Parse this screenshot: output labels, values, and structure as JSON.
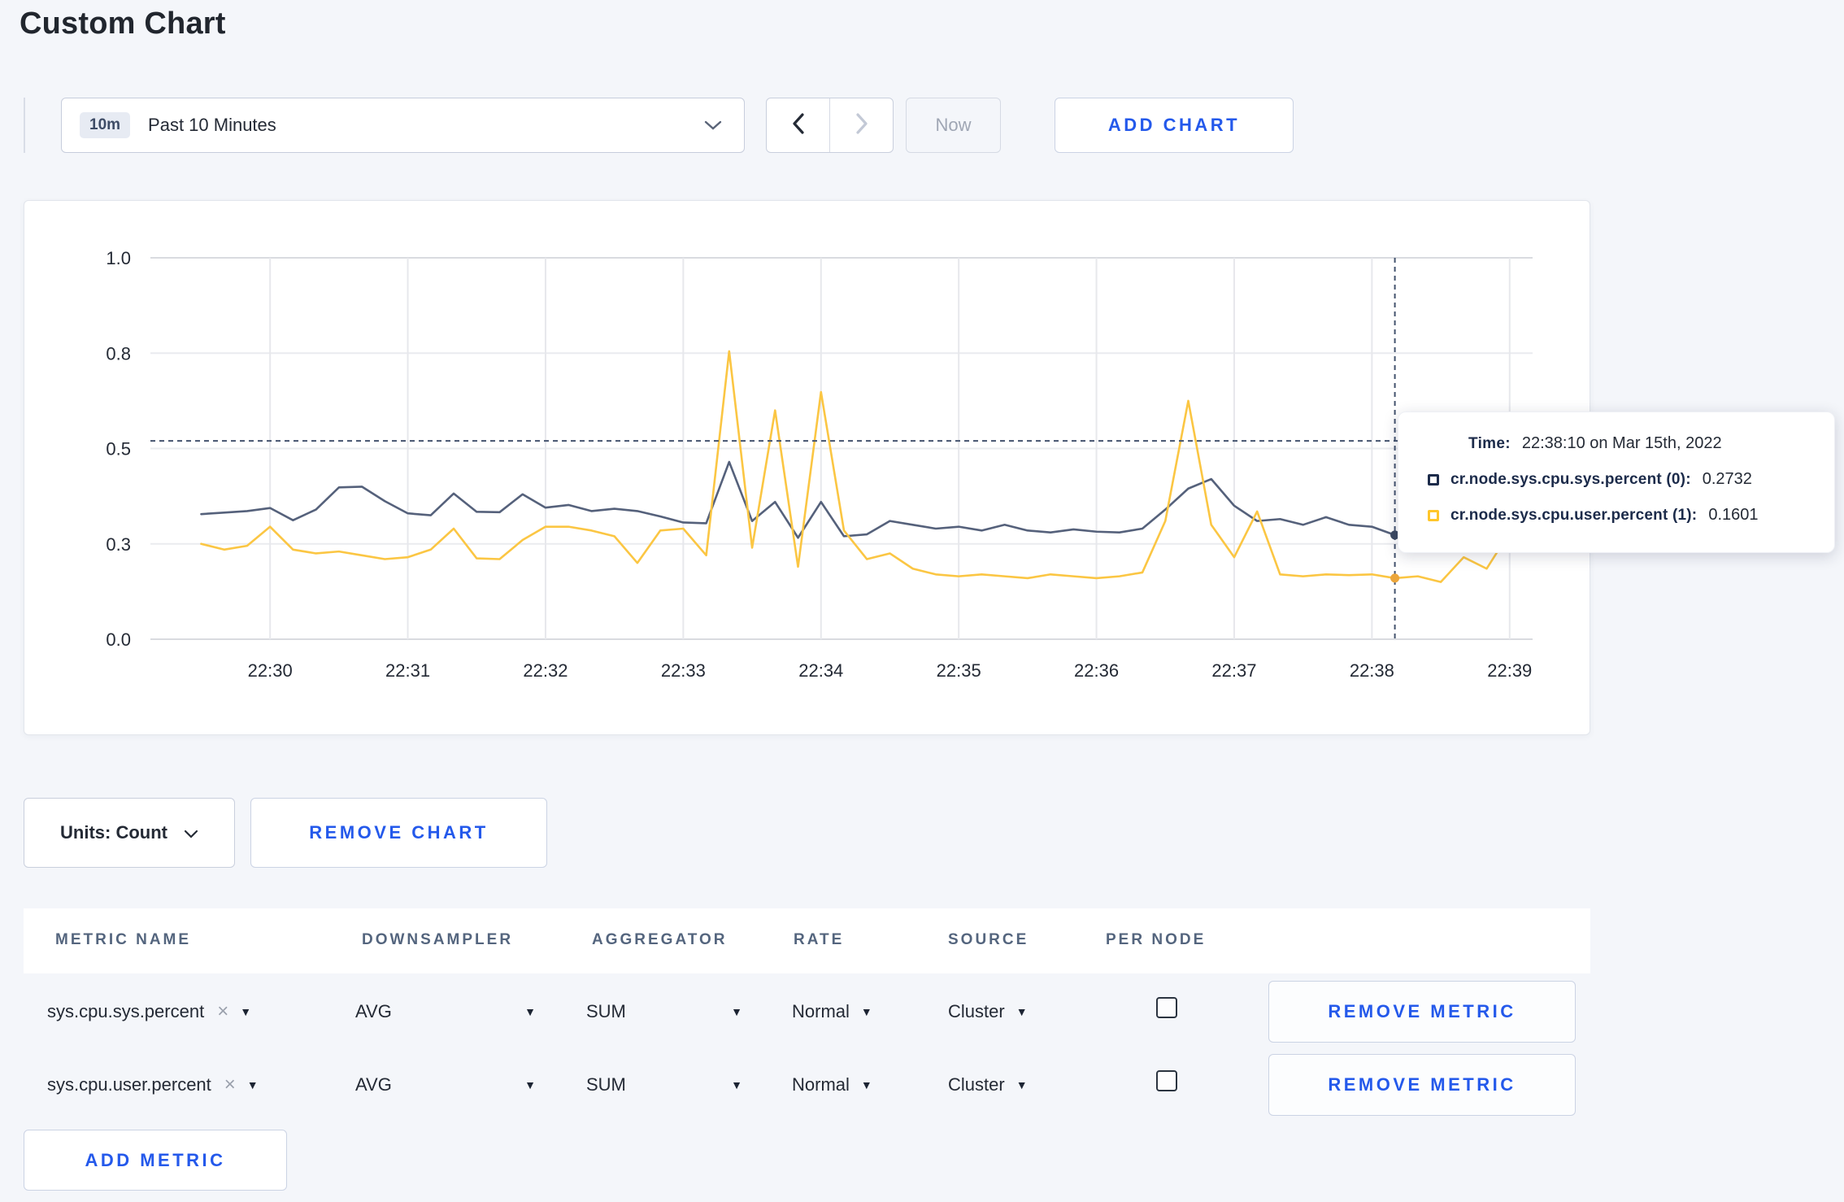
{
  "page": {
    "title": "Custom Chart",
    "background_color": "#F4F6FA",
    "accent_blue": "#2459EB"
  },
  "icons": {
    "caret_down": "▼",
    "close": "×"
  },
  "toolbar": {
    "time_badge": "10m",
    "time_label": "Past 10 Minutes",
    "now_label": "Now",
    "add_chart_label": "ADD CHART"
  },
  "chart_controls": {
    "units_label": "Units: Count",
    "remove_chart_label": "REMOVE CHART"
  },
  "tooltip": {
    "time_label": "Time:",
    "time_value": "22:38:10 on Mar 15th, 2022",
    "rows": [
      {
        "name": "cr.node.sys.cpu.sys.percent (0):",
        "value": "0.2732",
        "swatch_color": "#1C2B4A"
      },
      {
        "name": "cr.node.sys.cpu.user.percent (1):",
        "value": "0.1601",
        "swatch_color": "#FFC62B"
      }
    ]
  },
  "chart_data": {
    "type": "line",
    "title": "",
    "xlabel": "",
    "ylabel": "",
    "grid": true,
    "legend_position": "tooltip",
    "x_axis": {
      "domain": [
        "22:29:10",
        "22:39:10"
      ],
      "tick_labels": [
        "22:30",
        "22:31",
        "22:32",
        "22:33",
        "22:34",
        "22:35",
        "22:36",
        "22:37",
        "22:38",
        "22:39"
      ]
    },
    "y_axis": {
      "range": [
        0,
        1
      ],
      "tick_values": [
        0,
        0.25,
        0.5,
        0.75,
        1
      ],
      "tick_labels": [
        "0.0",
        "0.3",
        "0.5",
        "0.8",
        "1.0"
      ]
    },
    "sample_interval_seconds": 10,
    "times": [
      "22:29:30",
      "22:29:40",
      "22:29:50",
      "22:30:00",
      "22:30:10",
      "22:30:20",
      "22:30:30",
      "22:30:40",
      "22:30:50",
      "22:31:00",
      "22:31:10",
      "22:31:20",
      "22:31:30",
      "22:31:40",
      "22:31:50",
      "22:32:00",
      "22:32:10",
      "22:32:20",
      "22:32:30",
      "22:32:40",
      "22:32:50",
      "22:33:00",
      "22:33:10",
      "22:33:20",
      "22:33:30",
      "22:33:40",
      "22:33:50",
      "22:34:00",
      "22:34:10",
      "22:34:20",
      "22:34:30",
      "22:34:40",
      "22:34:50",
      "22:35:00",
      "22:35:10",
      "22:35:20",
      "22:35:30",
      "22:35:40",
      "22:35:50",
      "22:36:00",
      "22:36:10",
      "22:36:20",
      "22:36:30",
      "22:36:40",
      "22:36:50",
      "22:37:00",
      "22:37:10",
      "22:37:20",
      "22:37:30",
      "22:37:40",
      "22:37:50",
      "22:38:00",
      "22:38:10",
      "22:38:20",
      "22:38:30",
      "22:38:40",
      "22:38:50",
      "22:39:00",
      "22:39:10"
    ],
    "series": [
      {
        "name": "cr.node.sys.cpu.sys.percent",
        "color": "#55617B",
        "marker_color": "#3C4A63",
        "values": [
          0.328,
          0.332,
          0.336,
          0.344,
          0.312,
          0.34,
          0.398,
          0.4,
          0.362,
          0.33,
          0.325,
          0.382,
          0.334,
          0.333,
          0.38,
          0.345,
          0.352,
          0.336,
          0.342,
          0.336,
          0.322,
          0.306,
          0.304,
          0.465,
          0.31,
          0.36,
          0.266,
          0.36,
          0.27,
          0.275,
          0.31,
          0.3,
          0.29,
          0.295,
          0.285,
          0.3,
          0.285,
          0.28,
          0.288,
          0.282,
          0.28,
          0.29,
          0.34,
          0.395,
          0.42,
          0.35,
          0.31,
          0.315,
          0.3,
          0.32,
          0.3,
          0.295,
          0.2732,
          0.3,
          0.31,
          0.3,
          0.31,
          0.3,
          0.28
        ]
      },
      {
        "name": "cr.node.sys.cpu.user.percent",
        "color": "#FBC643",
        "marker_color": "#ECA63B",
        "values": [
          0.25,
          0.235,
          0.245,
          0.295,
          0.235,
          0.225,
          0.23,
          0.22,
          0.21,
          0.215,
          0.235,
          0.29,
          0.212,
          0.21,
          0.26,
          0.295,
          0.295,
          0.285,
          0.27,
          0.2,
          0.285,
          0.29,
          0.22,
          0.755,
          0.24,
          0.6,
          0.19,
          0.648,
          0.285,
          0.21,
          0.225,
          0.185,
          0.17,
          0.165,
          0.17,
          0.165,
          0.16,
          0.17,
          0.165,
          0.16,
          0.165,
          0.175,
          0.31,
          0.625,
          0.3,
          0.215,
          0.335,
          0.17,
          0.165,
          0.17,
          0.168,
          0.17,
          0.1601,
          0.165,
          0.15,
          0.215,
          0.185,
          0.28,
          0.25
        ]
      }
    ],
    "crosshair": {
      "time": "22:38:10",
      "hover_value": 0.52
    }
  },
  "metrics_table": {
    "headers": [
      "METRIC NAME",
      "DOWNSAMPLER",
      "AGGREGATOR",
      "RATE",
      "SOURCE",
      "PER NODE"
    ],
    "rows": [
      {
        "metric_name": "sys.cpu.sys.percent",
        "downsampler": "AVG",
        "aggregator": "SUM",
        "rate": "Normal",
        "source": "Cluster",
        "per_node_checked": false,
        "remove_label": "REMOVE METRIC"
      },
      {
        "metric_name": "sys.cpu.user.percent",
        "downsampler": "AVG",
        "aggregator": "SUM",
        "rate": "Normal",
        "source": "Cluster",
        "per_node_checked": false,
        "remove_label": "REMOVE METRIC"
      }
    ],
    "add_metric_label": "ADD METRIC"
  }
}
